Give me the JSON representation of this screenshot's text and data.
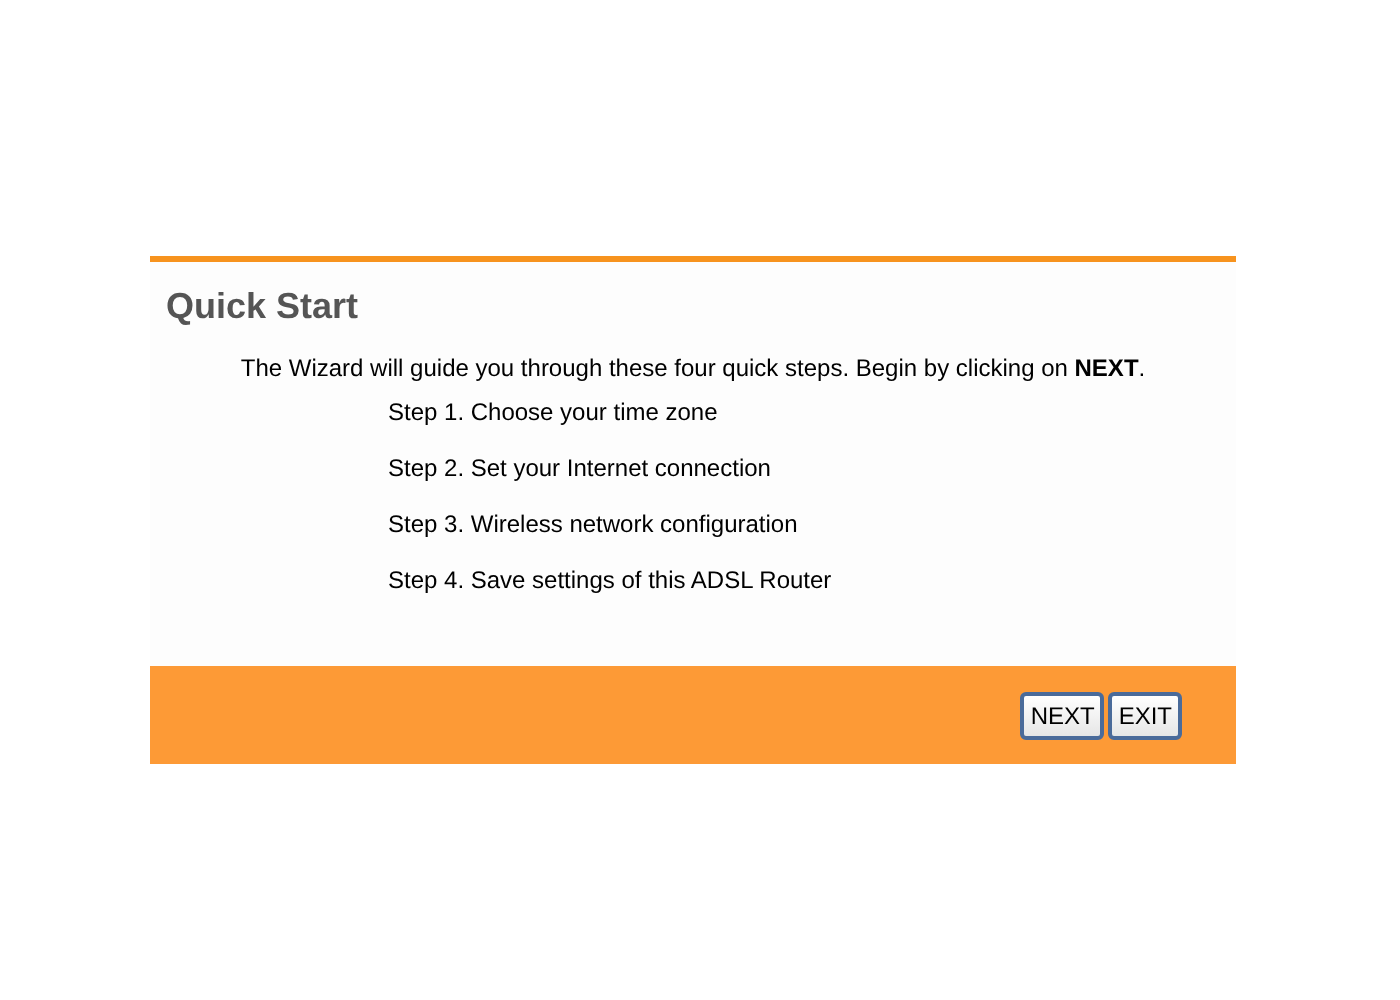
{
  "title": "Quick Start",
  "intro": "The Wizard will guide you through these four quick steps. Begin by clicking on **NEXT**.",
  "steps": [
    "Step 1. Choose your time zone",
    "Step 2. Set your Internet connection",
    "Step 3. Wireless network configuration",
    "Step 4. Save settings of this ADSL Router"
  ],
  "buttons": [
    "NEXT",
    "EXIT"
  ]
}
